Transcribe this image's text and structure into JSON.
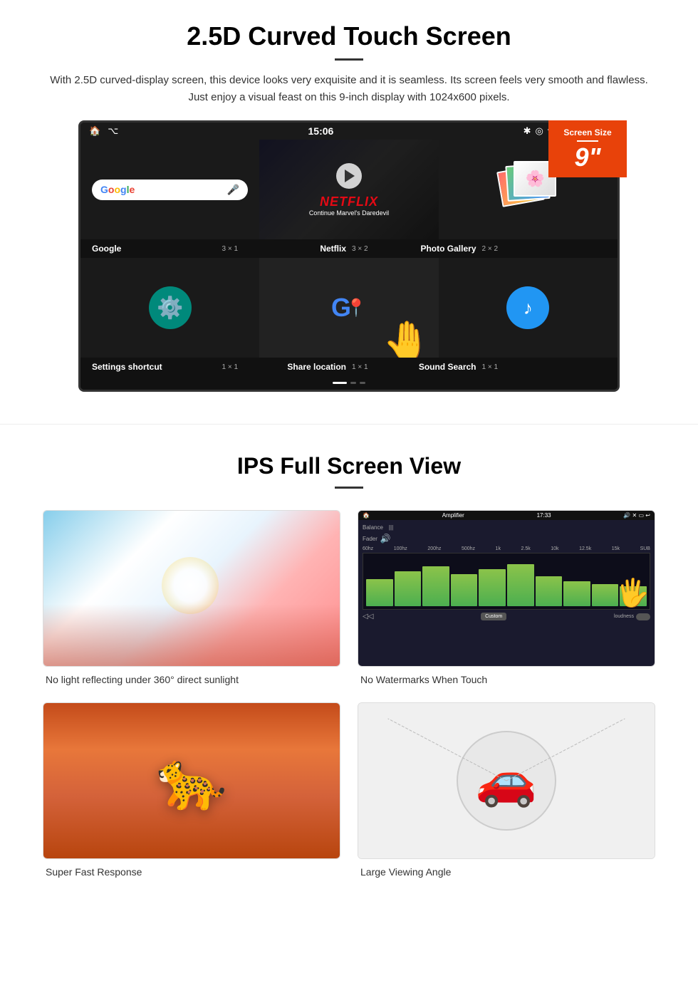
{
  "section1": {
    "title": "2.5D Curved Touch Screen",
    "description": "With 2.5D curved-display screen, this device looks very exquisite and it is seamless. Its screen feels very smooth and flawless. Just enjoy a visual feast on this 9-inch display with 1024x600 pixels.",
    "badge": {
      "label": "Screen Size",
      "size": "9\""
    },
    "statusBar": {
      "time": "15:06"
    },
    "apps": [
      {
        "name": "Google",
        "size": "3 × 1"
      },
      {
        "name": "Netflix",
        "size": "3 × 2"
      },
      {
        "name": "Photo Gallery",
        "size": "2 × 2"
      },
      {
        "name": "Settings shortcut",
        "size": "1 × 1"
      },
      {
        "name": "Share location",
        "size": "1 × 1"
      },
      {
        "name": "Sound Search",
        "size": "1 × 1"
      }
    ],
    "netflix": {
      "logo": "NETFLIX",
      "subtitle": "Continue Marvel's Daredevil"
    }
  },
  "section2": {
    "title": "IPS Full Screen View",
    "features": [
      {
        "caption": "No light reflecting under 360° direct sunlight"
      },
      {
        "caption": "No Watermarks When Touch"
      },
      {
        "caption": "Super Fast Response"
      },
      {
        "caption": "Large Viewing Angle"
      }
    ],
    "amplifier": {
      "title": "Amplifier",
      "time": "17:33",
      "labels": [
        "60hz",
        "100hz",
        "200hz",
        "500hz",
        "1k",
        "2.5k",
        "10k",
        "12.5k",
        "15k",
        "SUB"
      ],
      "controls": {
        "custom": "Custom",
        "loudness": "loudness"
      }
    }
  }
}
